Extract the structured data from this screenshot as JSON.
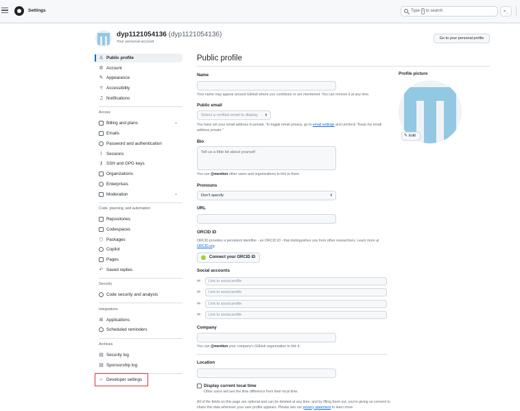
{
  "header": {
    "title": "Settings",
    "search_prefix": "Type",
    "search_key": "/",
    "search_suffix": "to search",
    "cmd_label": ">_"
  },
  "account": {
    "username": "dyp1121054136",
    "handle": "(dyp1121054136)",
    "subtitle": "Your personal account",
    "profile_button": "Go to your personal profile"
  },
  "sidebar": {
    "group1": [
      {
        "label": "Public profile",
        "icon": "person-icon",
        "active": true
      },
      {
        "label": "Account",
        "icon": "gear-icon"
      },
      {
        "label": "Appearance",
        "icon": "paintbrush-icon"
      },
      {
        "label": "Accessibility",
        "icon": "accessibility-icon"
      },
      {
        "label": "Notifications",
        "icon": "bell-icon"
      }
    ],
    "access_heading": "Access",
    "access": [
      {
        "label": "Billing and plans",
        "icon": "credit-card-icon",
        "chevron": true
      },
      {
        "label": "Emails",
        "icon": "mail-icon"
      },
      {
        "label": "Password and authentication",
        "icon": "shield-lock-icon"
      },
      {
        "label": "Sessions",
        "icon": "broadcast-icon"
      },
      {
        "label": "SSH and GPG keys",
        "icon": "key-icon"
      },
      {
        "label": "Organizations",
        "icon": "organization-icon"
      },
      {
        "label": "Enterprises",
        "icon": "globe-icon"
      },
      {
        "label": "Moderation",
        "icon": "report-icon",
        "chevron": true
      }
    ],
    "code_heading": "Code, planning, and automation",
    "code": [
      {
        "label": "Repositories",
        "icon": "repo-icon"
      },
      {
        "label": "Codespaces",
        "icon": "codespaces-icon"
      },
      {
        "label": "Packages",
        "icon": "package-icon"
      },
      {
        "label": "Copilot",
        "icon": "copilot-icon"
      },
      {
        "label": "Pages",
        "icon": "browser-icon"
      },
      {
        "label": "Saved replies",
        "icon": "reply-icon"
      }
    ],
    "security_heading": "Security",
    "security": [
      {
        "label": "Code security and analysis",
        "icon": "codescan-icon"
      }
    ],
    "integrations_heading": "Integrations",
    "integrations": [
      {
        "label": "Applications",
        "icon": "apps-icon"
      },
      {
        "label": "Scheduled reminders",
        "icon": "clock-icon"
      }
    ],
    "archives_heading": "Archives",
    "archives": [
      {
        "label": "Security log",
        "icon": "log-icon"
      },
      {
        "label": "Sponsorship log",
        "icon": "log-icon"
      }
    ],
    "developer": {
      "label": "Developer settings",
      "icon": "code-icon"
    }
  },
  "main": {
    "title": "Public profile",
    "name": {
      "label": "Name",
      "value": "",
      "note": "Your name may appear around GitHub where you contribute or are mentioned. You can remove it at any time."
    },
    "public_email": {
      "label": "Public email",
      "selected": "Select a verified email to display",
      "note_before": "You have set your email address to private. To toggle email privacy, go to",
      "note_link": "email settings",
      "note_after": "and uncheck \"Keep my email address private.\""
    },
    "bio": {
      "label": "Bio",
      "placeholder": "Tell us a little bit about yourself",
      "note_before": "You can",
      "note_mention": "@mention",
      "note_after": "other users and organizations to link to them."
    },
    "pronouns": {
      "label": "Pronouns",
      "selected": "Don't specify"
    },
    "url": {
      "label": "URL",
      "value": ""
    },
    "orcid": {
      "label": "ORCID iD",
      "note_before": "ORCID provides a persistent identifier - an ORCID iD - that distinguishes you from other researchers. Learn more at",
      "note_link": "ORCID.org",
      "note_after": ".",
      "button": "Connect your ORCID iD"
    },
    "social": {
      "label": "Social accounts",
      "placeholders": [
        "Link to social profile",
        "Link to social profile",
        "Link to social profile",
        "Link to social profile"
      ]
    },
    "company": {
      "label": "Company",
      "value": "",
      "note_before": "You can",
      "note_mention": "@mention",
      "note_after": "your company's GitHub organization to link it."
    },
    "location": {
      "label": "Location",
      "value": ""
    },
    "local_time": {
      "label": "Display current local time",
      "note": "Other users will see the time difference from their local time."
    },
    "footer": {
      "before": "All of the fields on this page are optional and can be deleted at any time, and by filling them out, you're giving us consent to share this data wherever your user profile appears. Please see our",
      "link": "privacy statement",
      "after": "to learn more"
    }
  },
  "profile_picture": {
    "label": "Profile picture",
    "edit": "Edit",
    "avatar_color": "#93c8e3"
  },
  "colors": {
    "accent": "#0969da",
    "highlight_box": "#e02b2b"
  }
}
